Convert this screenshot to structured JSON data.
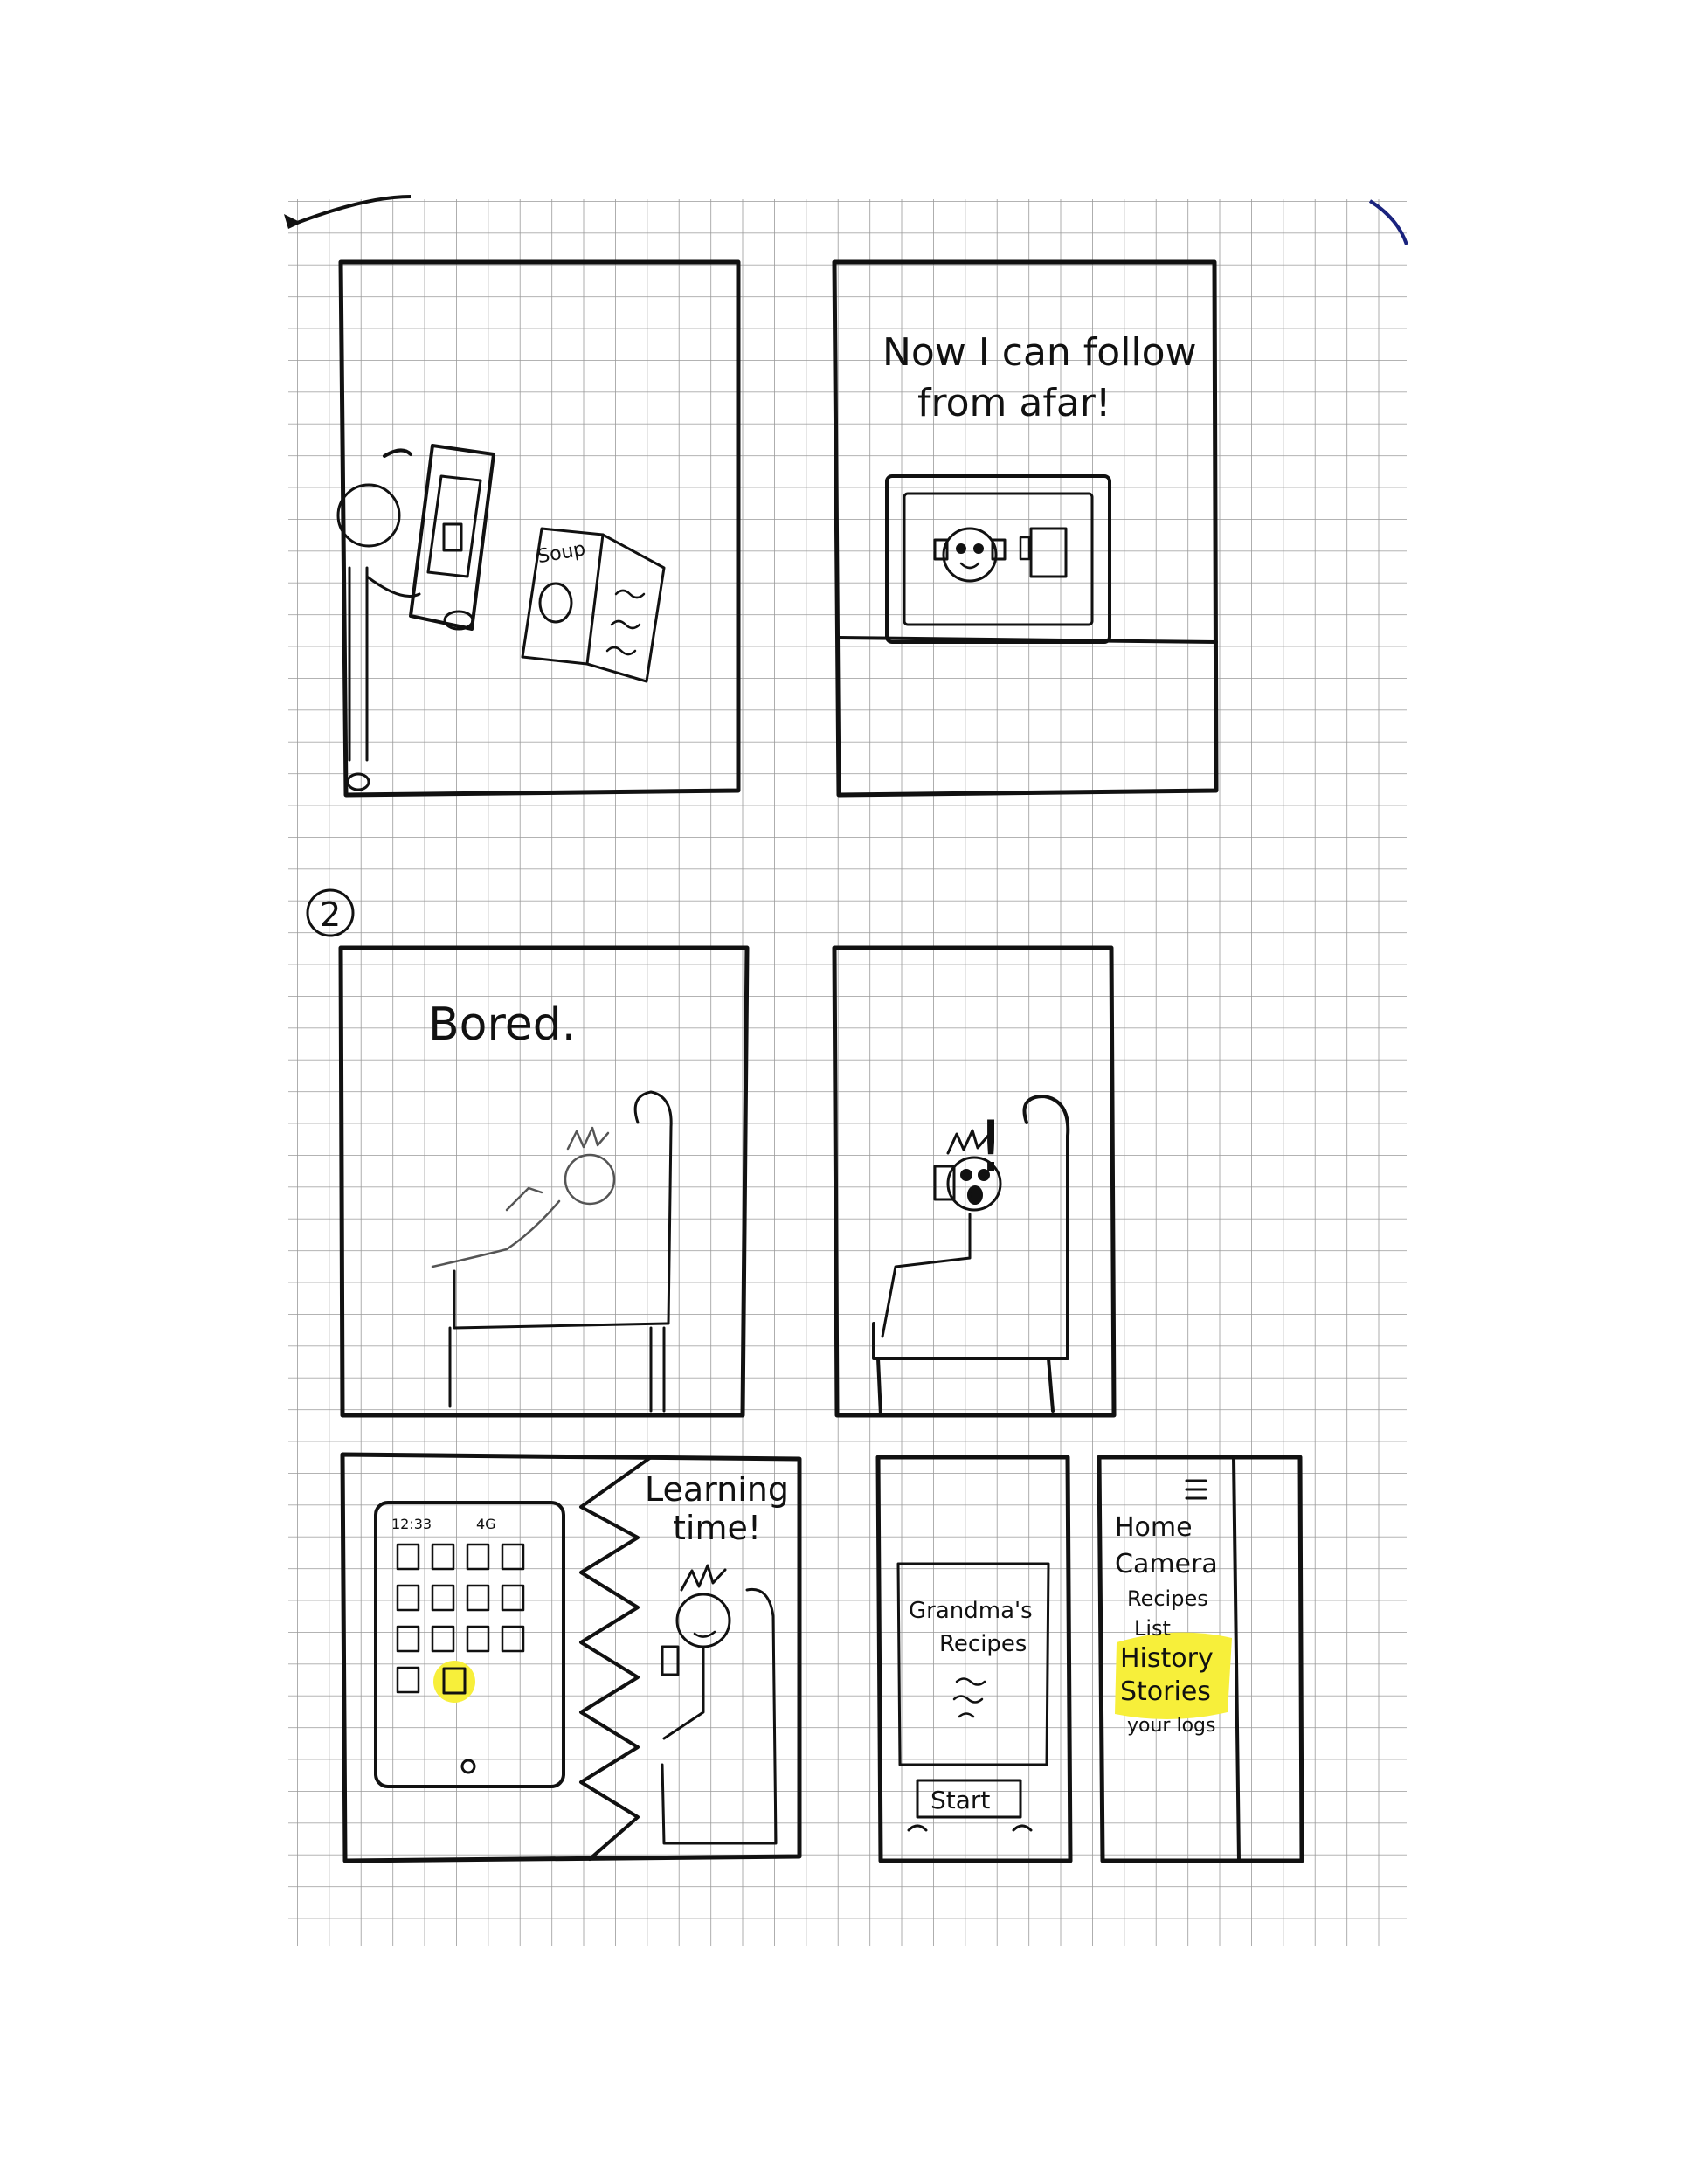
{
  "section_number": "2",
  "panels": {
    "soup": {
      "recipe_card_label": "Soup"
    },
    "follow": {
      "caption_line1": "Now I can follow",
      "caption_line2": "from afar!"
    },
    "bored": {
      "caption": "Bored."
    },
    "excited": {
      "exclamation": "!"
    },
    "learning": {
      "phone_time": "12:33",
      "phone_signal": "4G",
      "caption_line1": "Learning",
      "caption_line2": "time!"
    },
    "start": {
      "title_line1": "Grandma's",
      "title_line2": "Recipes",
      "start_button": "Start"
    },
    "menu": {
      "hamburger_icon": "menu-icon",
      "items": [
        "Home",
        "Camera",
        "Recipes",
        "List",
        "History",
        "Stories",
        "your logs"
      ],
      "highlight_color": "#f7ef3a"
    }
  }
}
